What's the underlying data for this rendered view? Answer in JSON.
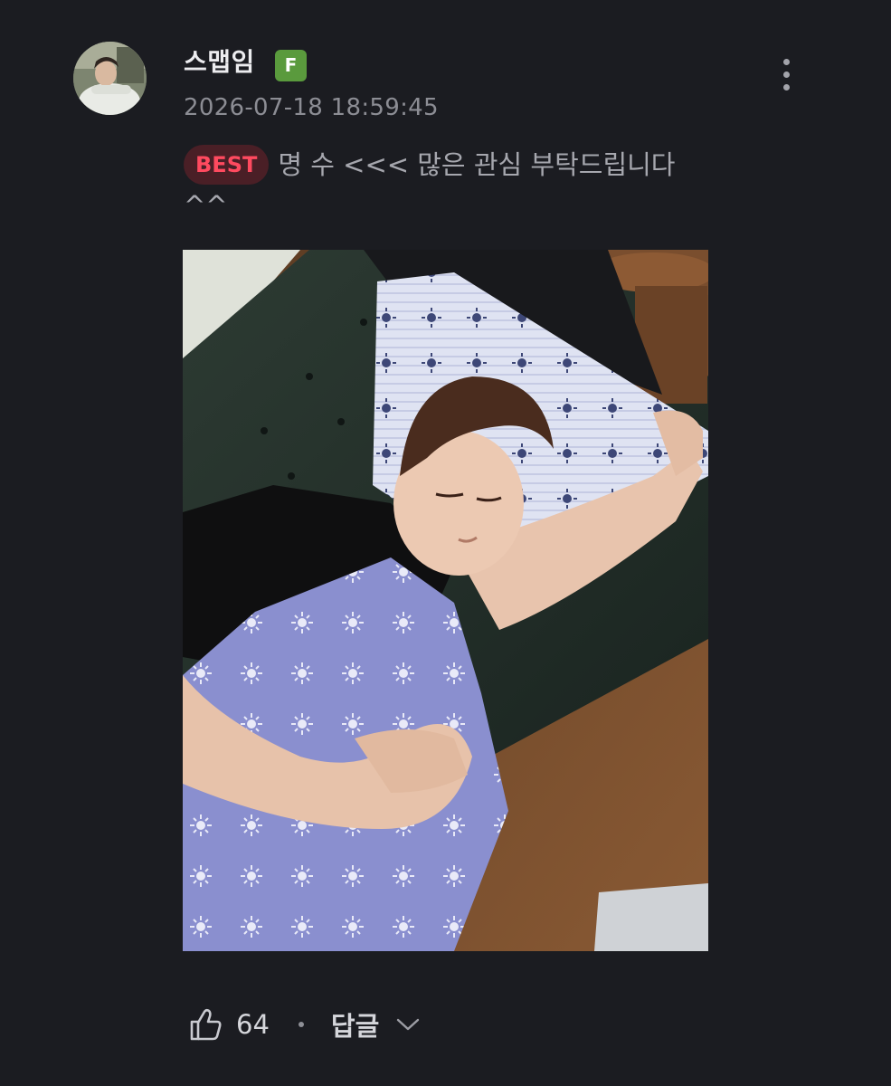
{
  "comment": {
    "author": {
      "username": "스맵임",
      "level_badge": "F",
      "level_badge_color": "#5a9a3d"
    },
    "timestamp": "2026-07-18 18:59:45",
    "best_badge": "BEST",
    "best_badge_color": "#ff4a5f",
    "text": "명 수 <<< 많은 관심 부탁드립니다 ^^",
    "photo": {
      "description_icon": "photo-sleeping-man"
    },
    "likes": "64",
    "reply_label": "답글"
  },
  "icons": {
    "more": "more-vertical-icon",
    "like": "thumbs-up-icon",
    "expand": "chevron-down-icon"
  },
  "theme": {
    "background": "#1b1c21",
    "text_primary": "#ececef",
    "text_secondary": "#8c8d94"
  }
}
